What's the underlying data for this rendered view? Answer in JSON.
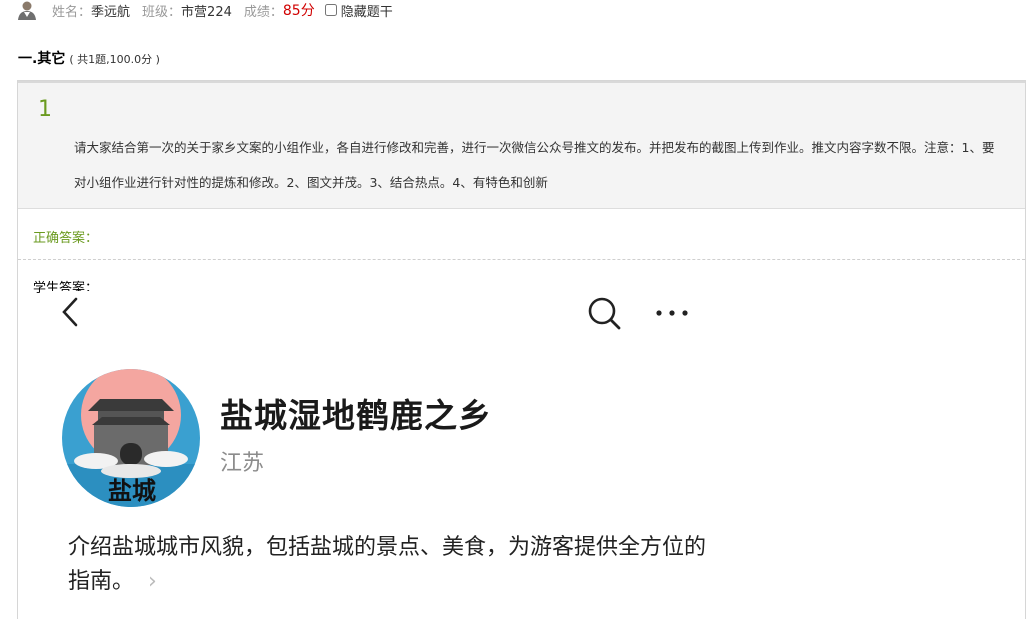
{
  "header": {
    "name_label": "姓名：",
    "name_value": "季远航",
    "class_label": "班级：",
    "class_value": "市营224",
    "score_label": "成绩：",
    "score_value": "85分",
    "hide_label": "隐藏题干"
  },
  "section": {
    "title": "一.其它",
    "sub": "( 共1题,100.0分 )"
  },
  "question": {
    "number": "1",
    "text": "请大家结合第一次的关于家乡文案的小组作业，各自进行修改和完善，进行一次微信公众号推文的发布。并把发布的截图上传到作业。推文内容字数不限。注意：1、要对小组作业进行针对性的提炼和修改。2、图文并茂。3、结合热点。4、有特色和创新",
    "correct_label": "正确答案：",
    "student_label": "学生答案："
  },
  "answer_screenshot": {
    "account_name": "盐城湿地鹤鹿之乡",
    "location": "江苏",
    "logo_text": "盐城",
    "description": "介绍盐城城市风貌，包括盐城的景点、美食，为游客提供全方位的指南。"
  },
  "colors": {
    "score": "#d00000",
    "accent_green": "#6a9a1f"
  }
}
